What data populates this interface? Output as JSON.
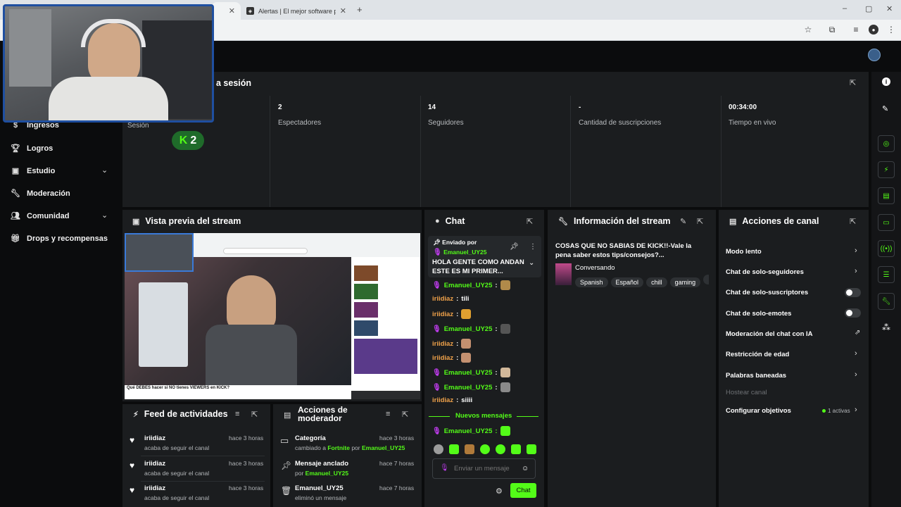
{
  "browser": {
    "tabs": [
      {
        "label": "",
        "active": true
      },
      {
        "label": "Alertas | El mejor software para",
        "active": false
      }
    ],
    "new_tab": "+",
    "window_controls": [
      "–",
      "▢",
      "✕"
    ]
  },
  "sidebar": {
    "items": [
      {
        "label": "Ingresos",
        "icon": "dollar-icon",
        "has_chevron": false
      },
      {
        "label": "Logros",
        "icon": "trophy-icon",
        "has_chevron": false
      },
      {
        "label": "Estudio",
        "icon": "studio-icon",
        "has_chevron": true
      },
      {
        "label": "Moderación",
        "icon": "wrench-icon",
        "has_chevron": false
      },
      {
        "label": "Comunidad",
        "icon": "users-icon",
        "has_chevron": true
      },
      {
        "label": "Drops y recompensas",
        "icon": "gift-icon",
        "has_chevron": false
      }
    ]
  },
  "session": {
    "title": "a sesión",
    "stats": [
      {
        "value": "",
        "label": "Sesión"
      },
      {
        "value": "2",
        "label": "Espectadores"
      },
      {
        "value": "14",
        "label": "Seguidores"
      },
      {
        "value": "-",
        "label": "Cantidad de suscripciones"
      },
      {
        "value": "00:34:00",
        "label": "Tiempo en vivo"
      }
    ],
    "badge": "2"
  },
  "preview": {
    "title": "Vista previa del stream",
    "caption": "Qué DEBES hacer si NO tienes VIEWERS en KICK?"
  },
  "feed": {
    "title": "Feed de actividades",
    "items": [
      {
        "name": "iriidiaz",
        "sub": "acaba de seguir el canal",
        "time": "hace 3 horas"
      },
      {
        "name": "iriidiaz",
        "sub": "acaba de seguir el canal",
        "time": "hace 3 horas"
      },
      {
        "name": "iriidiaz",
        "sub": "acaba de seguir el canal",
        "time": "hace 3 horas"
      }
    ]
  },
  "mod_actions": {
    "title_line1": "Acciones de",
    "title_line2": "moderador",
    "items": [
      {
        "name": "Categoría",
        "sub_prefix": "cambiado a ",
        "sub_hl1": "Fortnite",
        "sub_mid": " por ",
        "sub_hl2": "Emanuel_UY25",
        "time": "hace 3 horas"
      },
      {
        "name": "Mensaje anclado",
        "sub_prefix": "por ",
        "sub_hl1": "Emanuel_UY25",
        "sub_mid": "",
        "sub_hl2": "",
        "time": "hace 7 horas"
      },
      {
        "name": "Emanuel_UY25",
        "sub_prefix": "eliminó un mensaje",
        "sub_hl1": "",
        "sub_mid": "",
        "sub_hl2": "",
        "time": "hace 7 horas"
      }
    ]
  },
  "chat": {
    "title": "Chat",
    "pinned_by_label": "Enviado por",
    "pinned_user": "Emanuel_UY25",
    "pinned_text": "HOLA GENTE COMO ANDAN ESTE ES MI PRIMER...",
    "messages": [
      {
        "user": "Emanuel_UY25",
        "text": "",
        "mic": true,
        "color": "green",
        "emote": "#b08a4a"
      },
      {
        "user": "iriidiaz",
        "text": "tili",
        "mic": false,
        "color": "orange",
        "emote": ""
      },
      {
        "user": "iriidiaz",
        "text": "",
        "mic": false,
        "color": "orange",
        "emote": "#e0a030"
      },
      {
        "user": "Emanuel_UY25",
        "text": "",
        "mic": true,
        "color": "green",
        "emote": "#555555"
      },
      {
        "user": "iriidiaz",
        "text": "",
        "mic": false,
        "color": "orange",
        "emote": "#c49070"
      },
      {
        "user": "iriidiaz",
        "text": "",
        "mic": false,
        "color": "orange",
        "emote": "#c49070"
      },
      {
        "user": "Emanuel_UY25",
        "text": "",
        "mic": true,
        "color": "green",
        "emote": "#d2b89a"
      },
      {
        "user": "Emanuel_UY25",
        "text": "",
        "mic": true,
        "color": "green",
        "emote": "#8a8a8a"
      },
      {
        "user": "iriidiaz",
        "text": "siiii",
        "mic": false,
        "color": "orange",
        "emote": ""
      }
    ],
    "new_messages": "Nuevos mensajes",
    "last_message": {
      "user": "Emanuel_UY25",
      "emote": "#53fc18"
    },
    "input_placeholder": "Enviar un mensaje",
    "send_label": "Chat"
  },
  "stream_info": {
    "title": "Información del stream",
    "stream_title": "COSAS QUE NO SABIAS DE KICK!!-Vale la pena saber estos tips/consejos?...",
    "category": "Conversando",
    "tags": [
      "Spanish",
      "Español",
      "chill",
      "gaming"
    ]
  },
  "channel_actions": {
    "title": "Acciones de canal",
    "items": [
      {
        "label": "Modo lento",
        "control": "chevron"
      },
      {
        "label": "Chat de solo-seguidores",
        "control": "chevron"
      },
      {
        "label": "Chat de solo-suscriptores",
        "control": "toggle"
      },
      {
        "label": "Chat de solo-emotes",
        "control": "toggle"
      },
      {
        "label": "Moderación del chat con IA",
        "control": "external"
      },
      {
        "label": "Restricción de edad",
        "control": "chevron"
      },
      {
        "label": "Palabras baneadas",
        "control": "chevron"
      },
      {
        "label": "Hostear canal",
        "control": "none"
      },
      {
        "label": "Configurar objetivos",
        "control": "chevron"
      }
    ],
    "goals_active": "1 activas"
  },
  "colors": {
    "accent": "#53fc18",
    "panel": "#1b1d1f",
    "background": "#0b0c0d",
    "mic": "#c13cf0",
    "username_orange": "#f0a24a"
  }
}
